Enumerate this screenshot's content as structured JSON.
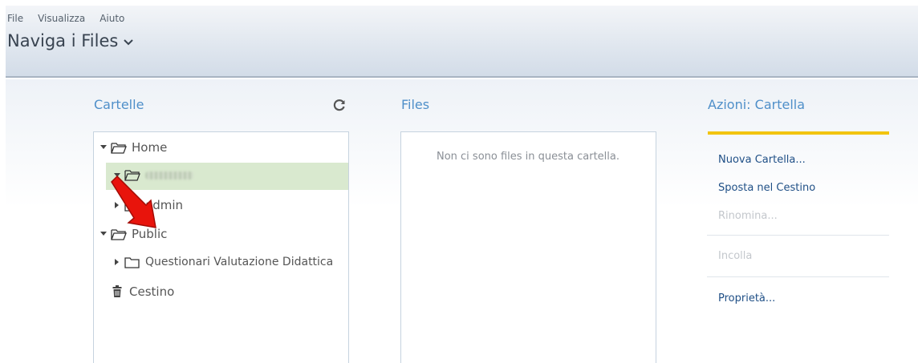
{
  "menu": {
    "file": "File",
    "view": "Visualizza",
    "help": "Aiuto"
  },
  "header": {
    "title": "Naviga i Files"
  },
  "folders": {
    "title": "Cartelle",
    "items": [
      {
        "label": "Home"
      },
      {
        "label": ""
      },
      {
        "label": "admin"
      },
      {
        "label": "Public"
      },
      {
        "label": "Questionari Valutazione Didattica"
      },
      {
        "label": "Cestino"
      }
    ]
  },
  "files": {
    "title": "Files",
    "empty_message": "Non ci sono files in questa cartella."
  },
  "actions": {
    "title": "Azioni: Cartella",
    "new_folder": "Nuova Cartella...",
    "move_to_trash": "Sposta nel Cestino",
    "rename": "Rinomina...",
    "paste": "Incolla",
    "properties": "Proprietà..."
  },
  "colors": {
    "accent": "#4f8fc9",
    "selection": "#d9e9cf",
    "highlight_bar": "#f2c40f",
    "arrow": "#e8140c"
  }
}
